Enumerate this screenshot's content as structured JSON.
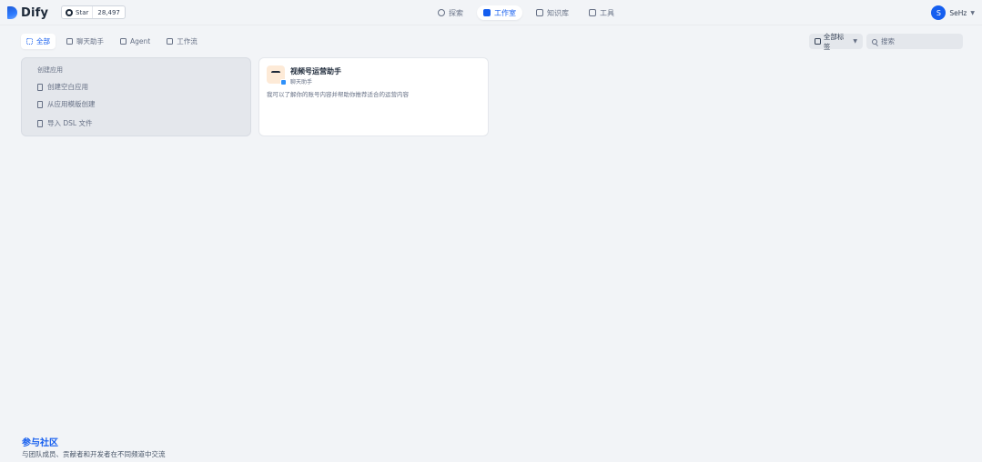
{
  "brand": {
    "logo_text": "Dify",
    "star_label": "Star",
    "star_count": "28,497"
  },
  "nav": [
    {
      "label": "探索",
      "icon": "compass-icon"
    },
    {
      "label": "工作室",
      "icon": "studio-icon",
      "active": true
    },
    {
      "label": "知识库",
      "icon": "book-icon"
    },
    {
      "label": "工具",
      "icon": "tool-icon"
    }
  ],
  "account": {
    "initial": "S",
    "name": "SeHz"
  },
  "filters": {
    "tabs": [
      {
        "label": "全部",
        "icon": "grid-icon",
        "active": true
      },
      {
        "label": "聊天助手",
        "icon": "chat-icon"
      },
      {
        "label": "Agent",
        "icon": "agent-icon"
      },
      {
        "label": "工作流",
        "icon": "workflow-icon"
      }
    ],
    "tag_label": "全部标签",
    "search_placeholder": "搜索"
  },
  "create": {
    "title": "创建应用",
    "items": [
      "创建空白应用",
      "从应用模版创建",
      "导入 DSL 文件"
    ]
  },
  "apps": [
    {
      "title": "视频号运营助手",
      "type": "聊天助手",
      "description": "我可以了解你的账号内容并帮助你推荐适合的运营内容"
    }
  ],
  "footer": {
    "title": "参与社区",
    "subtitle": "与团队成员、贡献者和开发者在不同频道中交流"
  },
  "colors": {
    "accent": "#155eef",
    "background": "#f2f4f7"
  }
}
